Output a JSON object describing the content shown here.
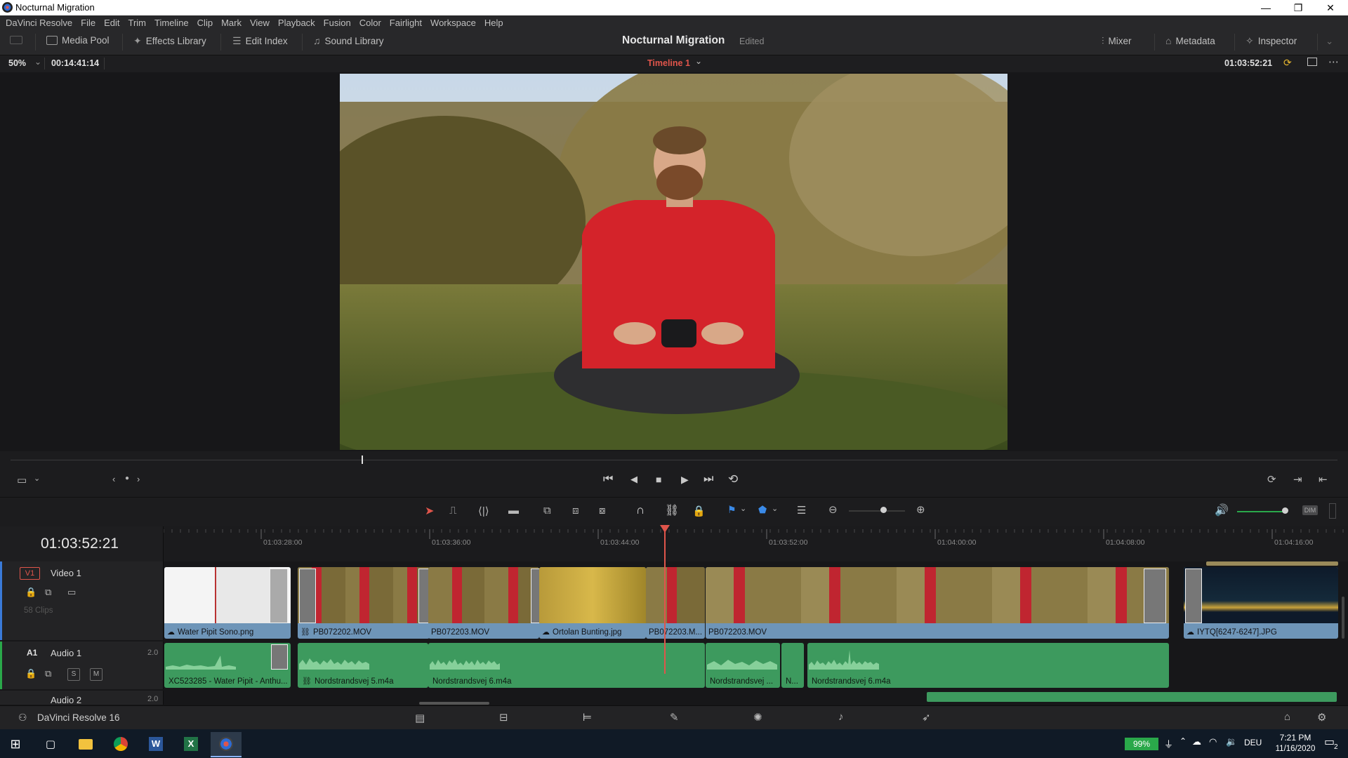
{
  "window": {
    "title": "Nocturnal Migration",
    "minimize": "—",
    "restore": "❐",
    "close": "✕"
  },
  "menu": [
    "DaVinci Resolve",
    "File",
    "Edit",
    "Trim",
    "Timeline",
    "Clip",
    "Mark",
    "View",
    "Playback",
    "Fusion",
    "Color",
    "Fairlight",
    "Workspace",
    "Help"
  ],
  "toolbar": {
    "media_pool": "Media Pool",
    "effects_library": "Effects Library",
    "edit_index": "Edit Index",
    "sound_library": "Sound Library",
    "project_title": "Nocturnal Migration",
    "project_status": "Edited",
    "mixer": "Mixer",
    "metadata": "Metadata",
    "inspector": "Inspector"
  },
  "viewer": {
    "zoom": "50%",
    "source_timecode": "00:14:41:14",
    "timeline_name": "Timeline 1",
    "timecode": "01:03:52:21"
  },
  "timeline": {
    "current_timecode": "01:03:52:21",
    "ruler_labels": [
      "01:03:28:00",
      "01:03:36:00",
      "01:03:44:00",
      "01:03:52:00",
      "01:04:00:00",
      "01:04:08:00",
      "01:04:16:00"
    ],
    "playhead_fraction": 0.423,
    "video_track": {
      "id": "V1",
      "name": "Video 1",
      "clips_count": "58 Clips"
    },
    "audio_track": {
      "id": "A1",
      "name": "Audio 1",
      "channels": "2.0"
    },
    "audio_track2": {
      "name": "Audio 2",
      "channels": "2.0"
    },
    "video_clips": [
      {
        "name": "Water Pipit Sono.png"
      },
      {
        "name": "PB072202.MOV"
      },
      {
        "name": "PB072203.MOV"
      },
      {
        "name": "Ortolan Bunting.jpg"
      },
      {
        "name": "PB072203.M..."
      },
      {
        "name": "PB072203.MOV"
      },
      {
        "name": "IYTQ[6247-6247].JPG"
      }
    ],
    "audio_clips": [
      {
        "name": "XC523285 - Water Pipit - Anthu..."
      },
      {
        "name": "Nordstrandsvej 5.m4a"
      },
      {
        "name": "Nordstrandsvej 6.m4a"
      },
      {
        "name": "Nordstrandsvej ..."
      },
      {
        "name": "N..."
      },
      {
        "name": "Nordstrandsvej 6.m4a"
      }
    ]
  },
  "pagebar": {
    "app_name": "DaVinci Resolve 16",
    "active_page": "edit"
  },
  "taskbar": {
    "battery": "99%",
    "language": "DEU",
    "time": "7:21 PM",
    "date": "11/16/2020",
    "notifications": "2"
  },
  "colors": {
    "accent_red": "#e0554b",
    "video_clip": "#6e95b8",
    "audio_clip": "#3d9a5e",
    "battery_green": "#2aa84a"
  }
}
